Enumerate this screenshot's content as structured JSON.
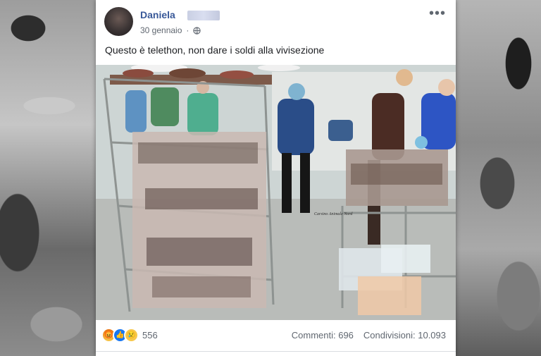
{
  "post": {
    "author": "Daniela",
    "date": "30 gennaio",
    "privacy_icon": "globe-icon",
    "more_icon": "more-options-icon",
    "text": "Questo è telethon, non dare i soldi alla vivisezione",
    "photo_watermark": "Carsino Animale Nord"
  },
  "engagement": {
    "reaction_icons": [
      "angry-reaction-icon",
      "like-reaction-icon",
      "sad-reaction-icon"
    ],
    "reaction_count": "556",
    "comments": "Commenti: 696",
    "shares": "Condivisioni: 10.093"
  },
  "colors": {
    "author_link": "#385898",
    "like_blue": "#1877f2",
    "text_dark": "#1c1e21",
    "text_muted": "#606770"
  }
}
